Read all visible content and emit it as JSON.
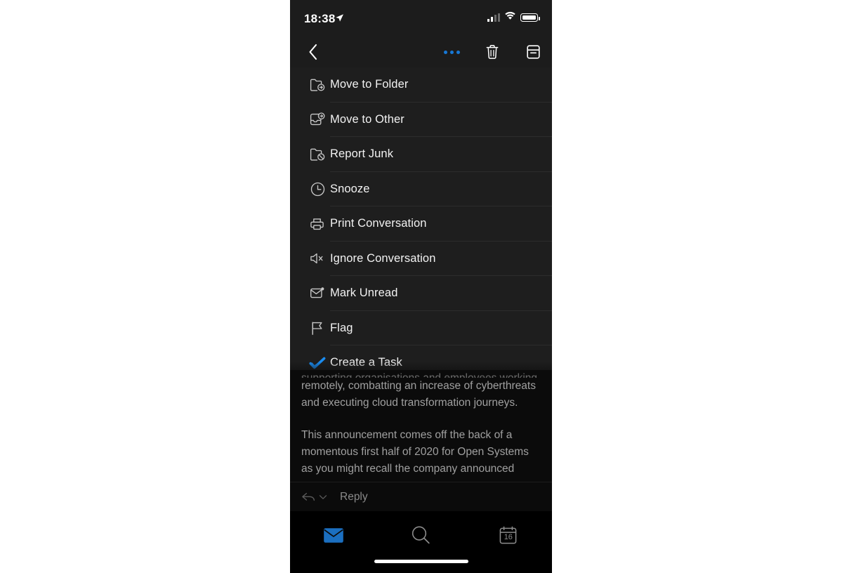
{
  "status_bar": {
    "time": "18:38",
    "location_icon": "location-arrow-icon",
    "signal_icon": "cellular-signal-icon",
    "wifi_icon": "wifi-icon",
    "battery_icon": "battery-icon"
  },
  "nav_bar": {
    "back_icon": "chevron-left-icon",
    "more_icon": "ellipsis-icon",
    "delete_icon": "trash-icon",
    "archive_icon": "archive-icon"
  },
  "action_menu": {
    "items": [
      {
        "label": "Move to Folder",
        "icon": "folder-move-icon",
        "accent": "#c7c7c7"
      },
      {
        "label": "Move to Other",
        "icon": "inbox-move-icon",
        "accent": "#c7c7c7"
      },
      {
        "label": "Report Junk",
        "icon": "folder-block-icon",
        "accent": "#c7c7c7"
      },
      {
        "label": "Snooze",
        "icon": "clock-icon",
        "accent": "#c7c7c7"
      },
      {
        "label": "Print Conversation",
        "icon": "printer-icon",
        "accent": "#c7c7c7"
      },
      {
        "label": "Ignore Conversation",
        "icon": "speaker-mute-icon",
        "accent": "#c7c7c7"
      },
      {
        "label": "Mark Unread",
        "icon": "envelope-unread-icon",
        "accent": "#c7c7c7"
      },
      {
        "label": "Flag",
        "icon": "flag-icon",
        "accent": "#c7c7c7"
      },
      {
        "label": "Create a Task",
        "icon": "check-task-icon",
        "accent": "#1a8cf0"
      }
    ]
  },
  "email_body": {
    "clipped_line": "supporting organisations and employees working",
    "paragraphs": [
      "remotely, combatting an increase of cyberthreats and executing cloud transformation journeys.",
      "This announcement comes off the back of a momentous first half of 2020 for Open Systems as you might recall the company announced"
    ]
  },
  "reply_bar": {
    "label": "Reply",
    "reply_icon": "reply-arrow-icon",
    "chevron_icon": "chevron-down-icon"
  },
  "tab_bar": {
    "tabs": [
      {
        "name": "mail",
        "icon": "envelope-icon",
        "active": true,
        "label": ""
      },
      {
        "name": "search",
        "icon": "search-icon",
        "active": false,
        "label": ""
      },
      {
        "name": "calendar",
        "icon": "calendar-icon",
        "active": false,
        "label": "16"
      }
    ]
  },
  "colors": {
    "accent_blue": "#1778d6",
    "task_blue": "#1a8cf0",
    "menu_bg": "#1e1e1e",
    "screen_bg": "#0b0b0b",
    "bar_bg": "#1c1c1c"
  }
}
